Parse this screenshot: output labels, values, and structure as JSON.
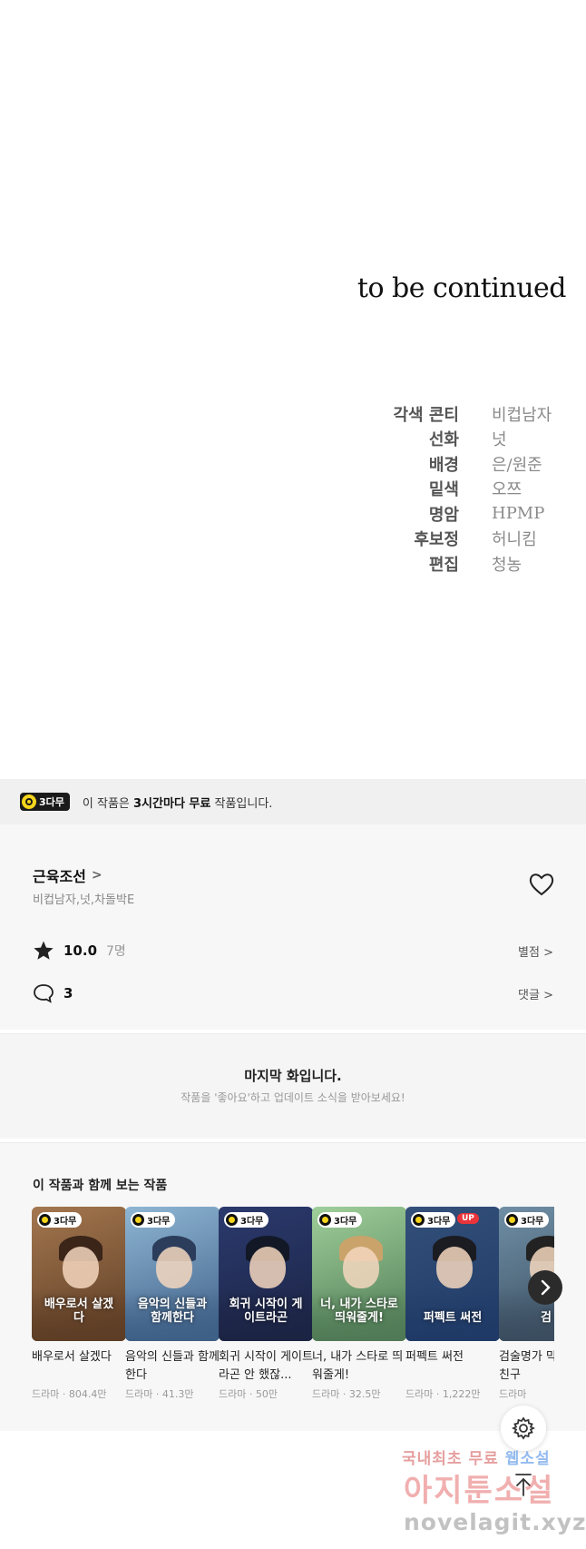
{
  "episode_end": {
    "to_be_continued": "to be continued",
    "credits": [
      {
        "role": "각색 콘티",
        "name": "비컵남자"
      },
      {
        "role": "선화",
        "name": "넛"
      },
      {
        "role": "배경",
        "name": "은/원준"
      },
      {
        "role": "밑색",
        "name": "오쯔"
      },
      {
        "role": "명암",
        "name": "HPMP"
      },
      {
        "role": "후보정",
        "name": "허니킴"
      },
      {
        "role": "편집",
        "name": "청농"
      }
    ]
  },
  "free_banner": {
    "badge": "3다무",
    "text_prefix": "이 작품은 ",
    "text_bold": "3시간마다 무료",
    "text_suffix": " 작품입니다."
  },
  "work": {
    "title": "근육조선",
    "title_chevron": ">",
    "authors": "비컵남자,넛,차돌박E",
    "rating": "10.0",
    "rating_count": "7명",
    "rating_link": "별점 >",
    "comments": "3",
    "comments_link": "댓글 >"
  },
  "last_episode": {
    "title": "마지막 화입니다.",
    "subtitle": "작품을 '좋아요'하고 업데이트 소식을 받아보세요!"
  },
  "recommendations": {
    "heading": "이 작품과 함께 보는 작품",
    "items": [
      {
        "badge": "3다무",
        "thumb_text": "배우로서 살겠다",
        "title": "배우로서 살겠다",
        "meta": "드라마 · 804.4만",
        "bg": "#a4774f",
        "art": "#5d3d25",
        "hair": "#3b2418",
        "up": ""
      },
      {
        "badge": "3다무",
        "thumb_text": "음악의 신들과 함께한다",
        "title": "음악의 신들과 함께한다",
        "meta": "드라마 · 41.3만",
        "bg": "#8fb6d4",
        "art": "#3e5f86",
        "hair": "#2c3d5c",
        "up": ""
      },
      {
        "badge": "3다무",
        "thumb_text": "회귀 시작이 게이트라곤",
        "title": "회귀 시작이 게이트라곤 안 했잖...",
        "meta": "드라마 · 50만",
        "bg": "#2b3a6e",
        "art": "#1c2444",
        "hair": "#121826",
        "up": ""
      },
      {
        "badge": "3다무",
        "thumb_text": "너, 내가 스타로 띄워줄게!",
        "title": "너, 내가 스타로 띄워줄게!",
        "meta": "드라마 · 32.5만",
        "bg": "#9fcf9a",
        "art": "#4f7a55",
        "hair": "#c9a36a",
        "up": ""
      },
      {
        "badge": "3다무",
        "thumb_text": "퍼펙트 써전",
        "title": "퍼펙트 써전",
        "meta": "드라마 · 1,222만",
        "bg": "#33507a",
        "art": "#1f3a66",
        "hair": "#1b1b22",
        "up": "UP"
      },
      {
        "badge": "3다무",
        "thumb_text": "검",
        "title": "검술명가 막내아들 친구",
        "meta": "드라마",
        "bg": "#6f8fa6",
        "art": "#3a4c5e",
        "hair": "#222",
        "up": ""
      }
    ]
  },
  "watermark": {
    "line1_a": "국내최초 무료",
    "line1_b": "웹소설",
    "line2": "아지툰소설",
    "line3": "novelagit.xyz"
  }
}
